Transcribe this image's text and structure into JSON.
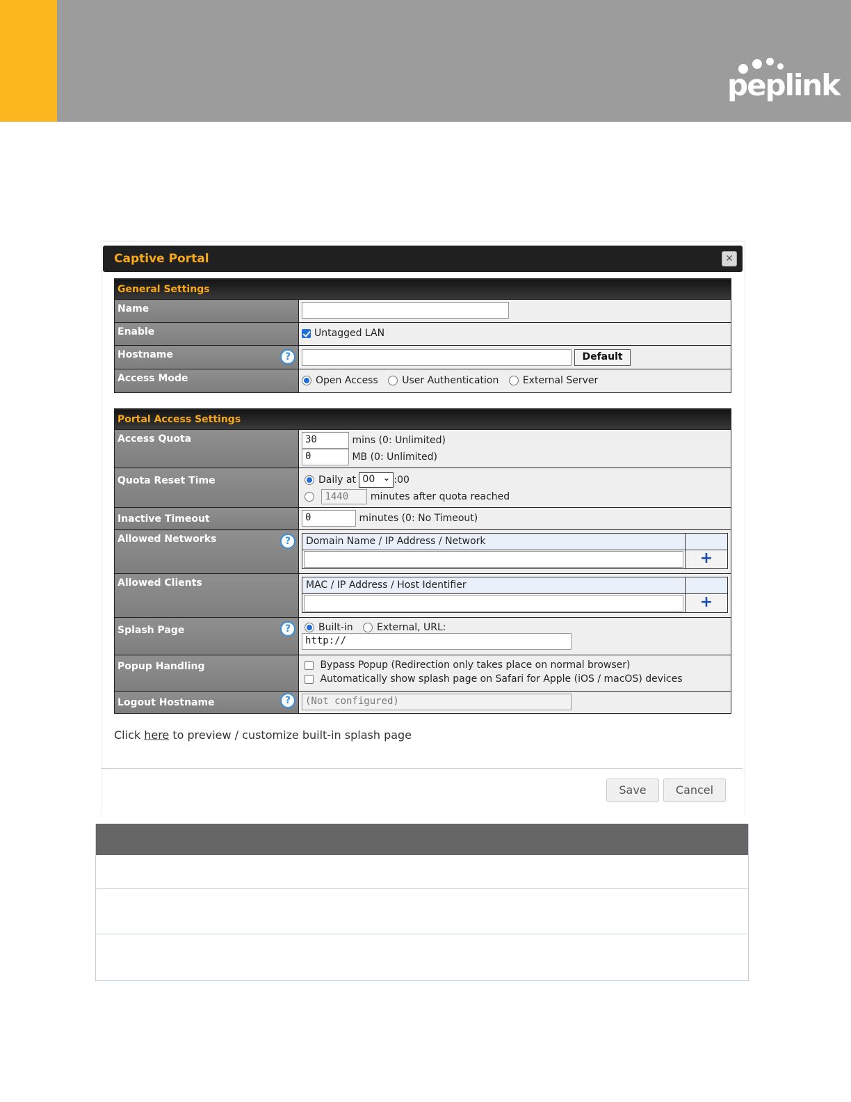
{
  "brand": {
    "logo_text": "peplink",
    "colors": {
      "accent": "#fcb71e",
      "header_bg": "#9c9c9c",
      "section_text": "#f7a81b"
    }
  },
  "dialog": {
    "title": "Captive Portal",
    "close_icon": "close-icon"
  },
  "general_settings": {
    "heading": "General Settings",
    "name": {
      "label": "Name",
      "value": ""
    },
    "enable": {
      "label": "Enable",
      "option": "Untagged LAN",
      "checked": true
    },
    "hostname": {
      "label": "Hostname",
      "value": "",
      "button": "Default"
    },
    "access_mode": {
      "label": "Access Mode",
      "options": [
        "Open Access",
        "User Authentication",
        "External Server"
      ],
      "selected": "Open Access"
    }
  },
  "portal_access": {
    "heading": "Portal Access Settings",
    "access_quota": {
      "label": "Access Quota",
      "mins_value": "30",
      "mins_suffix": "mins (0: Unlimited)",
      "mb_value": "0",
      "mb_suffix": "MB (0: Unlimited)"
    },
    "quota_reset": {
      "label": "Quota Reset Time",
      "daily_label": "Daily at",
      "hour": "00",
      "hour_suffix": ":00",
      "minutes_value": "1440",
      "minutes_suffix": "minutes after quota reached",
      "selected": "daily"
    },
    "inactive_timeout": {
      "label": "Inactive Timeout",
      "value": "0",
      "suffix": "minutes (0: No Timeout)"
    },
    "allowed_networks": {
      "label": "Allowed Networks",
      "column": "Domain Name / IP Address / Network",
      "add": "+"
    },
    "allowed_clients": {
      "label": "Allowed Clients",
      "column": "MAC / IP Address / Host Identifier",
      "add": "+"
    },
    "splash_page": {
      "label": "Splash Page",
      "options": [
        "Built-in",
        "External, URL:"
      ],
      "selected": "Built-in",
      "url_value": "http://"
    },
    "popup_handling": {
      "label": "Popup Handling",
      "options": [
        "Bypass Popup (Redirection only takes place on normal browser)",
        "Automatically show splash page on Safari for Apple (iOS / macOS) devices"
      ]
    },
    "logout_hostname": {
      "label": "Logout Hostname",
      "placeholder": "(Not configured)"
    }
  },
  "preview": {
    "prefix": "Click",
    "link": "here",
    "suffix": "to preview / customize built-in splash page"
  },
  "actions": {
    "save": "Save",
    "cancel": "Cancel"
  }
}
